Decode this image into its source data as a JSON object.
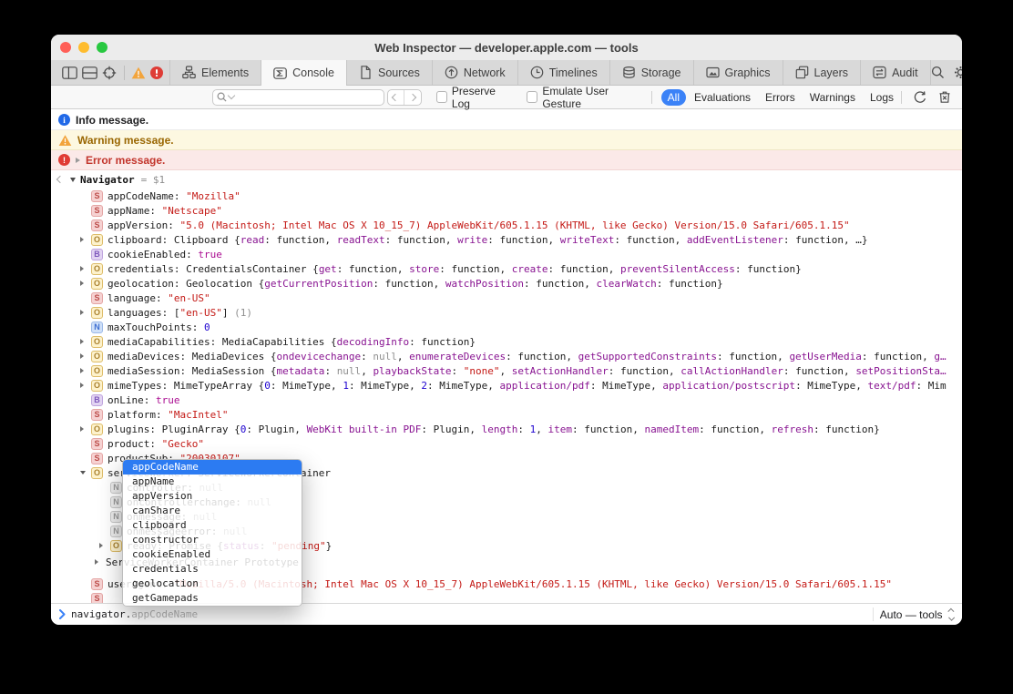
{
  "window": {
    "title": "Web Inspector — developer.apple.com — tools"
  },
  "colors": {
    "accent": "#3b82f7",
    "string_red": "#c41a16",
    "number_blue": "#1c00cf",
    "key_purple": "#881391",
    "keyword_magenta": "#aa0d91",
    "warning_bg": "#fdf8e1",
    "error_bg": "#fbe9e8",
    "selection_blue": "#2c7bf2"
  },
  "tabbar": {
    "active": "Console",
    "tabs": [
      {
        "label": "Elements",
        "icon": "elements-icon"
      },
      {
        "label": "Console",
        "icon": "console-icon"
      },
      {
        "label": "Sources",
        "icon": "sources-icon"
      },
      {
        "label": "Network",
        "icon": "network-icon"
      },
      {
        "label": "Timelines",
        "icon": "timelines-icon"
      },
      {
        "label": "Storage",
        "icon": "storage-icon"
      },
      {
        "label": "Graphics",
        "icon": "graphics-icon"
      },
      {
        "label": "Layers",
        "icon": "layers-icon"
      },
      {
        "label": "Audit",
        "icon": "audit-icon"
      }
    ]
  },
  "filterbar": {
    "search_value": "",
    "checkboxes": [
      "Preserve Log",
      "Emulate User Gesture"
    ],
    "scopes": [
      "All",
      "Evaluations",
      "Errors",
      "Warnings",
      "Logs"
    ],
    "active_scope": "All"
  },
  "messages": [
    {
      "type": "info",
      "text": "Info message."
    },
    {
      "type": "warning",
      "text": "Warning message."
    },
    {
      "type": "error",
      "text": "Error message."
    }
  ],
  "console": {
    "header": {
      "object_name": "Navigator",
      "saved_ref": "= $1"
    },
    "rows": [
      {
        "ind": 1,
        "arrow": "",
        "badge": "S",
        "name": "appCodeName",
        "value": [
          [
            "p",
            ": "
          ],
          [
            "s",
            "\"Mozilla\""
          ]
        ]
      },
      {
        "ind": 1,
        "arrow": "",
        "badge": "S",
        "name": "appName",
        "value": [
          [
            "p",
            ": "
          ],
          [
            "s",
            "\"Netscape\""
          ]
        ]
      },
      {
        "ind": 1,
        "arrow": "",
        "badge": "S",
        "name": "appVersion",
        "value": [
          [
            "p",
            ": "
          ],
          [
            "s",
            "\"5.0 (Macintosh; Intel Mac OS X 10_15_7) AppleWebKit/605.1.15 (KHTML, like Gecko) Version/15.0 Safari/605.1.15\""
          ]
        ]
      },
      {
        "ind": 1,
        "arrow": "r",
        "badge": "O",
        "name": "clipboard",
        "value": [
          [
            "p",
            ": Clipboard {"
          ],
          [
            "k",
            "read"
          ],
          [
            "p",
            ": function, "
          ],
          [
            "k",
            "readText"
          ],
          [
            "p",
            ": function, "
          ],
          [
            "k",
            "write"
          ],
          [
            "p",
            ": function, "
          ],
          [
            "k",
            "writeText"
          ],
          [
            "p",
            ": function, "
          ],
          [
            "k",
            "addEventListener"
          ],
          [
            "p",
            ": function, …}"
          ]
        ]
      },
      {
        "ind": 1,
        "arrow": "",
        "badge": "B",
        "name": "cookieEnabled",
        "value": [
          [
            "p",
            ": "
          ],
          [
            "b",
            "true"
          ]
        ]
      },
      {
        "ind": 1,
        "arrow": "r",
        "badge": "O",
        "name": "credentials",
        "value": [
          [
            "p",
            ": CredentialsContainer {"
          ],
          [
            "k",
            "get"
          ],
          [
            "p",
            ": function, "
          ],
          [
            "k",
            "store"
          ],
          [
            "p",
            ": function, "
          ],
          [
            "k",
            "create"
          ],
          [
            "p",
            ": function, "
          ],
          [
            "k",
            "preventSilentAccess"
          ],
          [
            "p",
            ": function}"
          ]
        ]
      },
      {
        "ind": 1,
        "arrow": "r",
        "badge": "O",
        "name": "geolocation",
        "value": [
          [
            "p",
            ": Geolocation {"
          ],
          [
            "k",
            "getCurrentPosition"
          ],
          [
            "p",
            ": function, "
          ],
          [
            "k",
            "watchPosition"
          ],
          [
            "p",
            ": function, "
          ],
          [
            "k",
            "clearWatch"
          ],
          [
            "p",
            ": function}"
          ]
        ]
      },
      {
        "ind": 1,
        "arrow": "",
        "badge": "S",
        "name": "language",
        "value": [
          [
            "p",
            ": "
          ],
          [
            "s",
            "\"en-US\""
          ]
        ]
      },
      {
        "ind": 1,
        "arrow": "r",
        "badge": "O",
        "name": "languages",
        "value": [
          [
            "p",
            ": ["
          ],
          [
            "s",
            "\"en-US\""
          ],
          [
            "p",
            "]"
          ],
          [
            "d",
            " (1)"
          ]
        ]
      },
      {
        "ind": 1,
        "arrow": "",
        "badge": "N",
        "name": "maxTouchPoints",
        "value": [
          [
            "p",
            ": "
          ],
          [
            "n",
            "0"
          ]
        ]
      },
      {
        "ind": 1,
        "arrow": "r",
        "badge": "O",
        "name": "mediaCapabilities",
        "value": [
          [
            "p",
            ": MediaCapabilities {"
          ],
          [
            "k",
            "decodingInfo"
          ],
          [
            "p",
            ": function}"
          ]
        ]
      },
      {
        "ind": 1,
        "arrow": "r",
        "badge": "O",
        "name": "mediaDevices",
        "value": [
          [
            "p",
            ": MediaDevices {"
          ],
          [
            "k",
            "ondevicechange"
          ],
          [
            "p",
            ": "
          ],
          [
            "u",
            "null"
          ],
          [
            "p",
            ", "
          ],
          [
            "k",
            "enumerateDevices"
          ],
          [
            "p",
            ": function, "
          ],
          [
            "k",
            "getSupportedConstraints"
          ],
          [
            "p",
            ": function, "
          ],
          [
            "k",
            "getUserMedia"
          ],
          [
            "p",
            ": function, "
          ],
          [
            "k",
            "g…"
          ]
        ]
      },
      {
        "ind": 1,
        "arrow": "r",
        "badge": "O",
        "name": "mediaSession",
        "value": [
          [
            "p",
            ": MediaSession {"
          ],
          [
            "k",
            "metadata"
          ],
          [
            "p",
            ": "
          ],
          [
            "u",
            "null"
          ],
          [
            "p",
            ", "
          ],
          [
            "k",
            "playbackState"
          ],
          [
            "p",
            ": "
          ],
          [
            "s",
            "\"none\""
          ],
          [
            "p",
            ", "
          ],
          [
            "k",
            "setActionHandler"
          ],
          [
            "p",
            ": function, "
          ],
          [
            "k",
            "callActionHandler"
          ],
          [
            "p",
            ": function, "
          ],
          [
            "k",
            "setPositionSta…"
          ]
        ]
      },
      {
        "ind": 1,
        "arrow": "r",
        "badge": "O",
        "name": "mimeTypes",
        "value": [
          [
            "p",
            ": MimeTypeArray {"
          ],
          [
            "n",
            "0"
          ],
          [
            "p",
            ": MimeType, "
          ],
          [
            "n",
            "1"
          ],
          [
            "p",
            ": MimeType, "
          ],
          [
            "n",
            "2"
          ],
          [
            "p",
            ": MimeType, "
          ],
          [
            "k",
            "application/pdf"
          ],
          [
            "p",
            ": MimeType, "
          ],
          [
            "k",
            "application/postscript"
          ],
          [
            "p",
            ": MimeType, "
          ],
          [
            "k",
            "text/pdf"
          ],
          [
            "p",
            ": Mim"
          ]
        ]
      },
      {
        "ind": 1,
        "arrow": "",
        "badge": "B",
        "name": "onLine",
        "value": [
          [
            "p",
            ": "
          ],
          [
            "b",
            "true"
          ]
        ]
      },
      {
        "ind": 1,
        "arrow": "",
        "badge": "S",
        "name": "platform",
        "value": [
          [
            "p",
            ": "
          ],
          [
            "s",
            "\"MacIntel\""
          ]
        ]
      },
      {
        "ind": 1,
        "arrow": "r",
        "badge": "O",
        "name": "plugins",
        "value": [
          [
            "p",
            ": PluginArray {"
          ],
          [
            "n",
            "0"
          ],
          [
            "p",
            ": Plugin, "
          ],
          [
            "k",
            "WebKit built-in PDF"
          ],
          [
            "p",
            ": Plugin, "
          ],
          [
            "k",
            "length"
          ],
          [
            "p",
            ": "
          ],
          [
            "n",
            "1"
          ],
          [
            "p",
            ", "
          ],
          [
            "k",
            "item"
          ],
          [
            "p",
            ": function, "
          ],
          [
            "k",
            "namedItem"
          ],
          [
            "p",
            ": function, "
          ],
          [
            "k",
            "refresh"
          ],
          [
            "p",
            ": function}"
          ]
        ]
      },
      {
        "ind": 1,
        "arrow": "",
        "badge": "S",
        "name": "product",
        "value": [
          [
            "p",
            ": "
          ],
          [
            "s",
            "\"Gecko\""
          ]
        ]
      },
      {
        "ind": 1,
        "arrow": "",
        "badge": "S",
        "name": "productSub",
        "value": [
          [
            "p",
            ": "
          ],
          [
            "s",
            "\"20030107\""
          ]
        ]
      },
      {
        "ind": 1,
        "arrow": "d",
        "badge": "O",
        "name": "serviceWorker",
        "value": [
          [
            "p",
            ": ServiceWorkerContainer"
          ]
        ]
      },
      {
        "ind": 2,
        "arrow": "",
        "badge": "X",
        "name": "controller",
        "value": [
          [
            "p",
            ": "
          ],
          [
            "u",
            "null"
          ]
        ]
      },
      {
        "ind": 2,
        "arrow": "",
        "badge": "X",
        "name": "oncontrollerchange",
        "value": [
          [
            "p",
            ": "
          ],
          [
            "u",
            "null"
          ]
        ]
      },
      {
        "ind": 2,
        "arrow": "",
        "badge": "X",
        "name": "onmessage",
        "value": [
          [
            "p",
            ": "
          ],
          [
            "u",
            "null"
          ]
        ]
      },
      {
        "ind": 2,
        "arrow": "",
        "badge": "X",
        "name": "onmessageerror",
        "value": [
          [
            "p",
            ": "
          ],
          [
            "u",
            "null"
          ]
        ]
      },
      {
        "ind": 2,
        "arrow": "r",
        "badge": "O",
        "name": "ready",
        "value": [
          [
            "p",
            ": Promise {"
          ],
          [
            "k",
            "status"
          ],
          [
            "p",
            ": "
          ],
          [
            "s",
            "\"pending\""
          ],
          [
            "p",
            "}"
          ]
        ]
      },
      {
        "ind": 3,
        "arrow": "r",
        "badge": "",
        "name": "",
        "extra": "mt2",
        "value": [
          [
            "p",
            "ServiceWorkerContainer Prototype"
          ]
        ]
      },
      {
        "ind": 1,
        "arrow": "",
        "badge": "S",
        "name": "userAgent",
        "extra": "mt8",
        "value": [
          [
            "p",
            ": "
          ],
          [
            "s",
            "\"Mozilla/5.0 (Macintosh; Intel Mac OS X 10_15_7) AppleWebKit/605.1.15 (KHTML, like Gecko) Version/15.0 Safari/605.1.15\""
          ]
        ]
      },
      {
        "ind": 1,
        "arrow": "",
        "badge": "S",
        "name": "",
        "value": []
      }
    ]
  },
  "autocomplete": {
    "selected": "appCodeName",
    "items": [
      "appCodeName",
      "appName",
      "appVersion",
      "canShare",
      "clipboard",
      "constructor",
      "cookieEnabled",
      "credentials",
      "geolocation",
      "getGamepads"
    ]
  },
  "prompt": {
    "typed": "navigator.",
    "completion": "appCodeName"
  },
  "quick_console": {
    "execution_context": "Auto — tools"
  }
}
